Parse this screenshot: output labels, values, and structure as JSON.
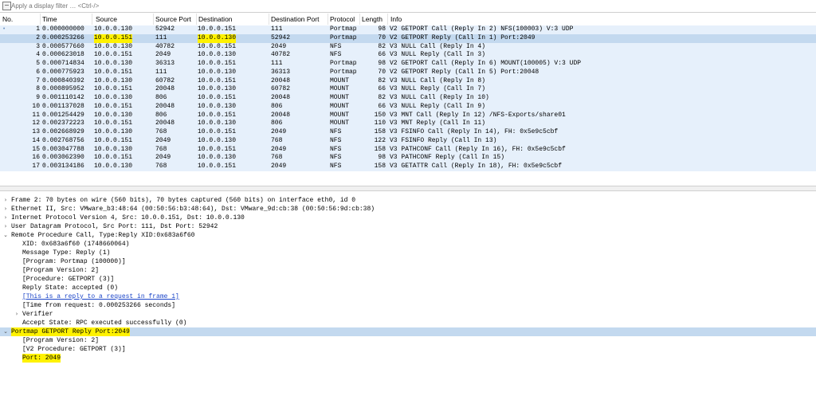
{
  "filter": {
    "placeholder": "Apply a display filter … <Ctrl-/>"
  },
  "columns": {
    "no": "No.",
    "time": "Time",
    "source": "Source",
    "source_port": "Source Port",
    "destination": "Destination",
    "destination_port": "Destination Port",
    "protocol": "Protocol",
    "length": "Length",
    "info": "Info"
  },
  "packets": [
    {
      "no": "1",
      "time": "0.000000000",
      "src": "10.0.0.130",
      "sport": "52942",
      "dst": "10.0.0.151",
      "dport": "111",
      "proto": "Portmap",
      "len": "98",
      "info": "V2 GETPORT Call (Reply In 2) NFS(100003) V:3 UDP"
    },
    {
      "no": "2",
      "time": "0.000253266",
      "src": "10.0.0.151",
      "sport": "111",
      "dst": "10.0.0.130",
      "dport": "52942",
      "proto": "Portmap",
      "len": "70",
      "info": "V2 GETPORT Reply (Call In 1) Port:2049"
    },
    {
      "no": "3",
      "time": "0.000577660",
      "src": "10.0.0.130",
      "sport": "40782",
      "dst": "10.0.0.151",
      "dport": "2049",
      "proto": "NFS",
      "len": "82",
      "info": "V3 NULL Call (Reply In 4)"
    },
    {
      "no": "4",
      "time": "0.000623018",
      "src": "10.0.0.151",
      "sport": "2049",
      "dst": "10.0.0.130",
      "dport": "40782",
      "proto": "NFS",
      "len": "66",
      "info": "V3 NULL Reply (Call In 3)"
    },
    {
      "no": "5",
      "time": "0.000714834",
      "src": "10.0.0.130",
      "sport": "36313",
      "dst": "10.0.0.151",
      "dport": "111",
      "proto": "Portmap",
      "len": "98",
      "info": "V2 GETPORT Call (Reply In 6) MOUNT(100005) V:3 UDP"
    },
    {
      "no": "6",
      "time": "0.000775923",
      "src": "10.0.0.151",
      "sport": "111",
      "dst": "10.0.0.130",
      "dport": "36313",
      "proto": "Portmap",
      "len": "70",
      "info": "V2 GETPORT Reply (Call In 5) Port:20048"
    },
    {
      "no": "7",
      "time": "0.000840392",
      "src": "10.0.0.130",
      "sport": "60782",
      "dst": "10.0.0.151",
      "dport": "20048",
      "proto": "MOUNT",
      "len": "82",
      "info": "V3 NULL Call (Reply In 8)"
    },
    {
      "no": "8",
      "time": "0.000895952",
      "src": "10.0.0.151",
      "sport": "20048",
      "dst": "10.0.0.130",
      "dport": "60782",
      "proto": "MOUNT",
      "len": "66",
      "info": "V3 NULL Reply (Call In 7)"
    },
    {
      "no": "9",
      "time": "0.001110142",
      "src": "10.0.0.130",
      "sport": "806",
      "dst": "10.0.0.151",
      "dport": "20048",
      "proto": "MOUNT",
      "len": "82",
      "info": "V3 NULL Call (Reply In 10)"
    },
    {
      "no": "10",
      "time": "0.001137028",
      "src": "10.0.0.151",
      "sport": "20048",
      "dst": "10.0.0.130",
      "dport": "806",
      "proto": "MOUNT",
      "len": "66",
      "info": "V3 NULL Reply (Call In 9)"
    },
    {
      "no": "11",
      "time": "0.001254429",
      "src": "10.0.0.130",
      "sport": "806",
      "dst": "10.0.0.151",
      "dport": "20048",
      "proto": "MOUNT",
      "len": "150",
      "info": "V3 MNT Call (Reply In 12) /NFS-Exports/share01"
    },
    {
      "no": "12",
      "time": "0.002372223",
      "src": "10.0.0.151",
      "sport": "20048",
      "dst": "10.0.0.130",
      "dport": "806",
      "proto": "MOUNT",
      "len": "110",
      "info": "V3 MNT Reply (Call In 11)"
    },
    {
      "no": "13",
      "time": "0.002668929",
      "src": "10.0.0.130",
      "sport": "768",
      "dst": "10.0.0.151",
      "dport": "2049",
      "proto": "NFS",
      "len": "158",
      "info": "V3 FSINFO Call (Reply In 14), FH: 0x5e9c5cbf"
    },
    {
      "no": "14",
      "time": "0.002768756",
      "src": "10.0.0.151",
      "sport": "2049",
      "dst": "10.0.0.130",
      "dport": "768",
      "proto": "NFS",
      "len": "122",
      "info": "V3 FSINFO Reply (Call In 13)"
    },
    {
      "no": "15",
      "time": "0.003047788",
      "src": "10.0.0.130",
      "sport": "768",
      "dst": "10.0.0.151",
      "dport": "2049",
      "proto": "NFS",
      "len": "158",
      "info": "V3 PATHCONF Call (Reply In 16), FH: 0x5e9c5cbf"
    },
    {
      "no": "16",
      "time": "0.003062390",
      "src": "10.0.0.151",
      "sport": "2049",
      "dst": "10.0.0.130",
      "dport": "768",
      "proto": "NFS",
      "len": "98",
      "info": "V3 PATHCONF Reply (Call In 15)"
    },
    {
      "no": "17",
      "time": "0.003134186",
      "src": "10.0.0.130",
      "sport": "768",
      "dst": "10.0.0.151",
      "dport": "2049",
      "proto": "NFS",
      "len": "158",
      "info": "V3 GETATTR Call (Reply In 18), FH: 0x5e9c5cbf"
    }
  ],
  "details": [
    {
      "arrow": ">",
      "indent": 0,
      "text": "Frame 2: 70 bytes on wire (560 bits), 70 bytes captured (560 bits) on interface eth0, id 0"
    },
    {
      "arrow": ">",
      "indent": 0,
      "text": "Ethernet II, Src: VMware_b3:48:64 (00:50:56:b3:48:64), Dst: VMware_9d:cb:38 (00:50:56:9d:cb:38)"
    },
    {
      "arrow": ">",
      "indent": 0,
      "text": "Internet Protocol Version 4, Src: 10.0.0.151, Dst: 10.0.0.130"
    },
    {
      "arrow": ">",
      "indent": 0,
      "text": "User Datagram Protocol, Src Port: 111, Dst Port: 52942"
    },
    {
      "arrow": "v",
      "indent": 0,
      "text": "Remote Procedure Call, Type:Reply XID:0x683a6f60"
    },
    {
      "arrow": "",
      "indent": 1,
      "text": "XID: 0x683a6f60 (1748660064)"
    },
    {
      "arrow": "",
      "indent": 1,
      "text": "Message Type: Reply (1)"
    },
    {
      "arrow": "",
      "indent": 1,
      "text": "[Program: Portmap (100000)]"
    },
    {
      "arrow": "",
      "indent": 1,
      "text": "[Program Version: 2]"
    },
    {
      "arrow": "",
      "indent": 1,
      "text": "[Procedure: GETPORT (3)]"
    },
    {
      "arrow": "",
      "indent": 1,
      "text": "Reply State: accepted (0)"
    },
    {
      "arrow": "",
      "indent": 1,
      "text": "[This is a reply to a request in frame 1]",
      "link": true
    },
    {
      "arrow": "",
      "indent": 1,
      "text": "[Time from request: 0.000253266 seconds]"
    },
    {
      "arrow": ">",
      "indent": 1,
      "text": "Verifier"
    },
    {
      "arrow": "",
      "indent": 1,
      "text": "Accept State: RPC executed successfully (0)"
    },
    {
      "arrow": "v",
      "indent": 0,
      "text": "Portmap GETPORT Reply Port:2049",
      "sel": true
    },
    {
      "arrow": "",
      "indent": 1,
      "text": "[Program Version: 2]"
    },
    {
      "arrow": "",
      "indent": 1,
      "text": "[V2 Procedure: GETPORT (3)]"
    },
    {
      "arrow": "",
      "indent": 1,
      "text": "Port: 2049"
    }
  ]
}
